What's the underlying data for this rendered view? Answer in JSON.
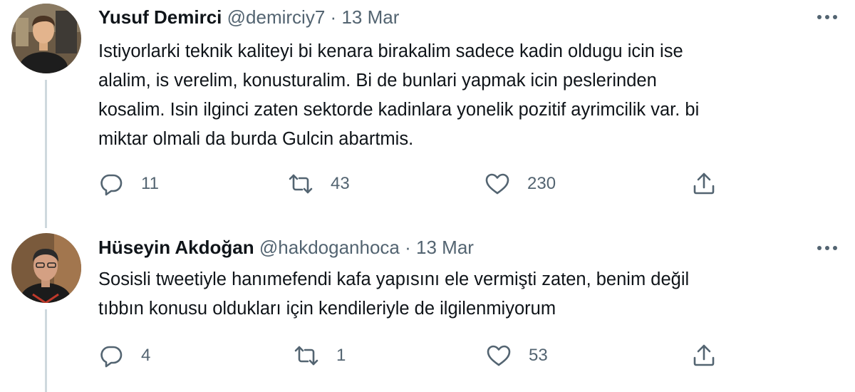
{
  "tweets": [
    {
      "name": "Yusuf Demirci",
      "handle": "@demirciy7",
      "separator": "·",
      "date": "13 Mar",
      "lines": [
        "Istiyorlarki teknik kaliteyi bi kenara birakalim sadece kadin oldugu icin ise",
        "alalim, is verelim, konusturalim. Bi de bunlari yapmak icin peslerinden",
        "kosalim. Isin ilginci zaten sektorde kadinlara yonelik pozitif ayrimcilik var. bi",
        "miktar olmali da burda Gulcin abartmis."
      ],
      "replies": "11",
      "retweets": "43",
      "likes": "230"
    },
    {
      "name": "Hüseyin Akdoğan",
      "handle": "@hakdoganhoca",
      "separator": "·",
      "date": "13 Mar",
      "lines": [
        "Sosisli tweetiyle hanımefendi kafa yapısını ele vermişti zaten, benim değil",
        "tıbbın konusu oldukları için kendileriyle de ilgilenmiyorum"
      ],
      "replies": "4",
      "retweets": "1",
      "likes": "53"
    }
  ],
  "icons": {
    "reply": "reply-icon",
    "retweet": "retweet-icon",
    "like": "heart-icon",
    "share": "share-icon",
    "more": "more-options-icon"
  },
  "colors": {
    "text": "#0f1419",
    "secondary": "#536471",
    "thread_line": "#cfd9de"
  }
}
